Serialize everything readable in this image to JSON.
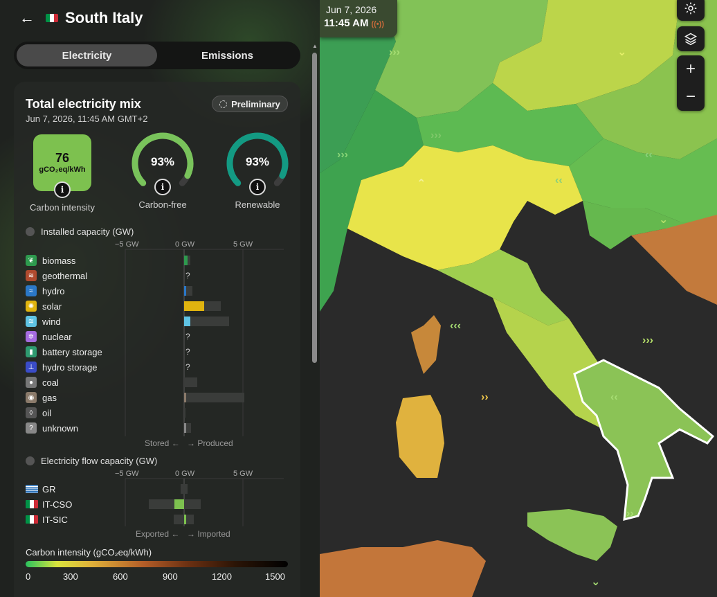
{
  "header": {
    "title": "South Italy",
    "flag_colors": [
      "#009246",
      "#ffffff",
      "#ce2b37"
    ]
  },
  "tabs": [
    {
      "label": "Electricity",
      "active": true
    },
    {
      "label": "Emissions",
      "active": false
    }
  ],
  "map_time": {
    "date": "Jun 7, 2026",
    "time": "11:45 AM"
  },
  "mix": {
    "title": "Total electricity mix",
    "date": "Jun 7, 2026, 11:45 AM GMT+2",
    "badge": "Preliminary",
    "carbon_intensity": {
      "value": "76",
      "unit": "gCO₂eq/kWh",
      "label": "Carbon intensity"
    },
    "carbon_free": {
      "value": "93%",
      "label": "Carbon-free",
      "fraction": 0.93
    },
    "renewable": {
      "value": "93%",
      "label": "Renewable",
      "fraction": 0.93
    }
  },
  "installed": {
    "title": "Installed capacity (GW)",
    "axis": [
      "−5 GW",
      "0 GW",
      "5 GW"
    ],
    "footer_left": "Stored ←",
    "footer_right": "→ Produced",
    "sources": [
      {
        "name": "biomass",
        "icon": "leaf-icon",
        "color": "#2e9a4e",
        "produced": 0.3,
        "capacity": 0.5,
        "unknown": false
      },
      {
        "name": "geothermal",
        "icon": "geothermal-icon",
        "color": "#b04a2e",
        "produced": 0,
        "capacity": 0,
        "unknown": true
      },
      {
        "name": "hydro",
        "icon": "waves-icon",
        "color": "#2b78c8",
        "produced": 0.15,
        "capacity": 0.7,
        "unknown": false
      },
      {
        "name": "solar",
        "icon": "sun-icon",
        "color": "#e0b40f",
        "produced": 1.7,
        "capacity": 3.1,
        "unknown": false
      },
      {
        "name": "wind",
        "icon": "wind-icon",
        "color": "#5fc3e4",
        "produced": 0.5,
        "capacity": 3.8,
        "unknown": false
      },
      {
        "name": "nuclear",
        "icon": "atom-icon",
        "color": "#a66be0",
        "produced": 0,
        "capacity": 0,
        "unknown": true
      },
      {
        "name": "battery storage",
        "icon": "battery-icon",
        "color": "#2e9a70",
        "produced": 0,
        "capacity": 0,
        "unknown": true
      },
      {
        "name": "hydro storage",
        "icon": "dam-icon",
        "color": "#3a4cc8",
        "produced": 0,
        "capacity": 0,
        "unknown": true
      },
      {
        "name": "coal",
        "icon": "coal-icon",
        "color": "#777777",
        "produced": 0,
        "capacity": 1.1,
        "unknown": false
      },
      {
        "name": "gas",
        "icon": "flame-icon",
        "color": "#8a7a6a",
        "produced": 0.1,
        "capacity": 5.1,
        "unknown": false
      },
      {
        "name": "oil",
        "icon": "droplet-icon",
        "color": "#555555",
        "produced": 0,
        "capacity": 0.05,
        "unknown": false
      },
      {
        "name": "unknown",
        "icon": "question-icon",
        "color": "#888888",
        "produced": 0.05,
        "capacity": 0.6,
        "unknown": false
      }
    ]
  },
  "flows": {
    "title": "Electricity flow capacity (GW)",
    "axis": [
      "−5 GW",
      "0 GW",
      "5 GW"
    ],
    "footer_left": "Exported ←",
    "footer_right": "→ Imported",
    "rows": [
      {
        "name": "GR",
        "flag": "greece",
        "flow": 0,
        "cap_min": -0.3,
        "cap_max": 0.3
      },
      {
        "name": "IT-CSO",
        "flag": "italy",
        "flow": -0.8,
        "cap_min": -3.0,
        "cap_max": 1.4
      },
      {
        "name": "IT-SIC",
        "flag": "italy",
        "flow": 0.1,
        "cap_min": -0.9,
        "cap_max": 0.8
      }
    ]
  },
  "legend": {
    "title": "Carbon intensity (gCO₂eq/kWh)",
    "ticks": [
      "0",
      "300",
      "600",
      "900",
      "1200",
      "1500"
    ]
  },
  "colors": {
    "ci_green": "#7dc14f",
    "gauge_cf": "#79c35b",
    "gauge_re": "#139a83",
    "panel_bg": "#1f221f"
  }
}
